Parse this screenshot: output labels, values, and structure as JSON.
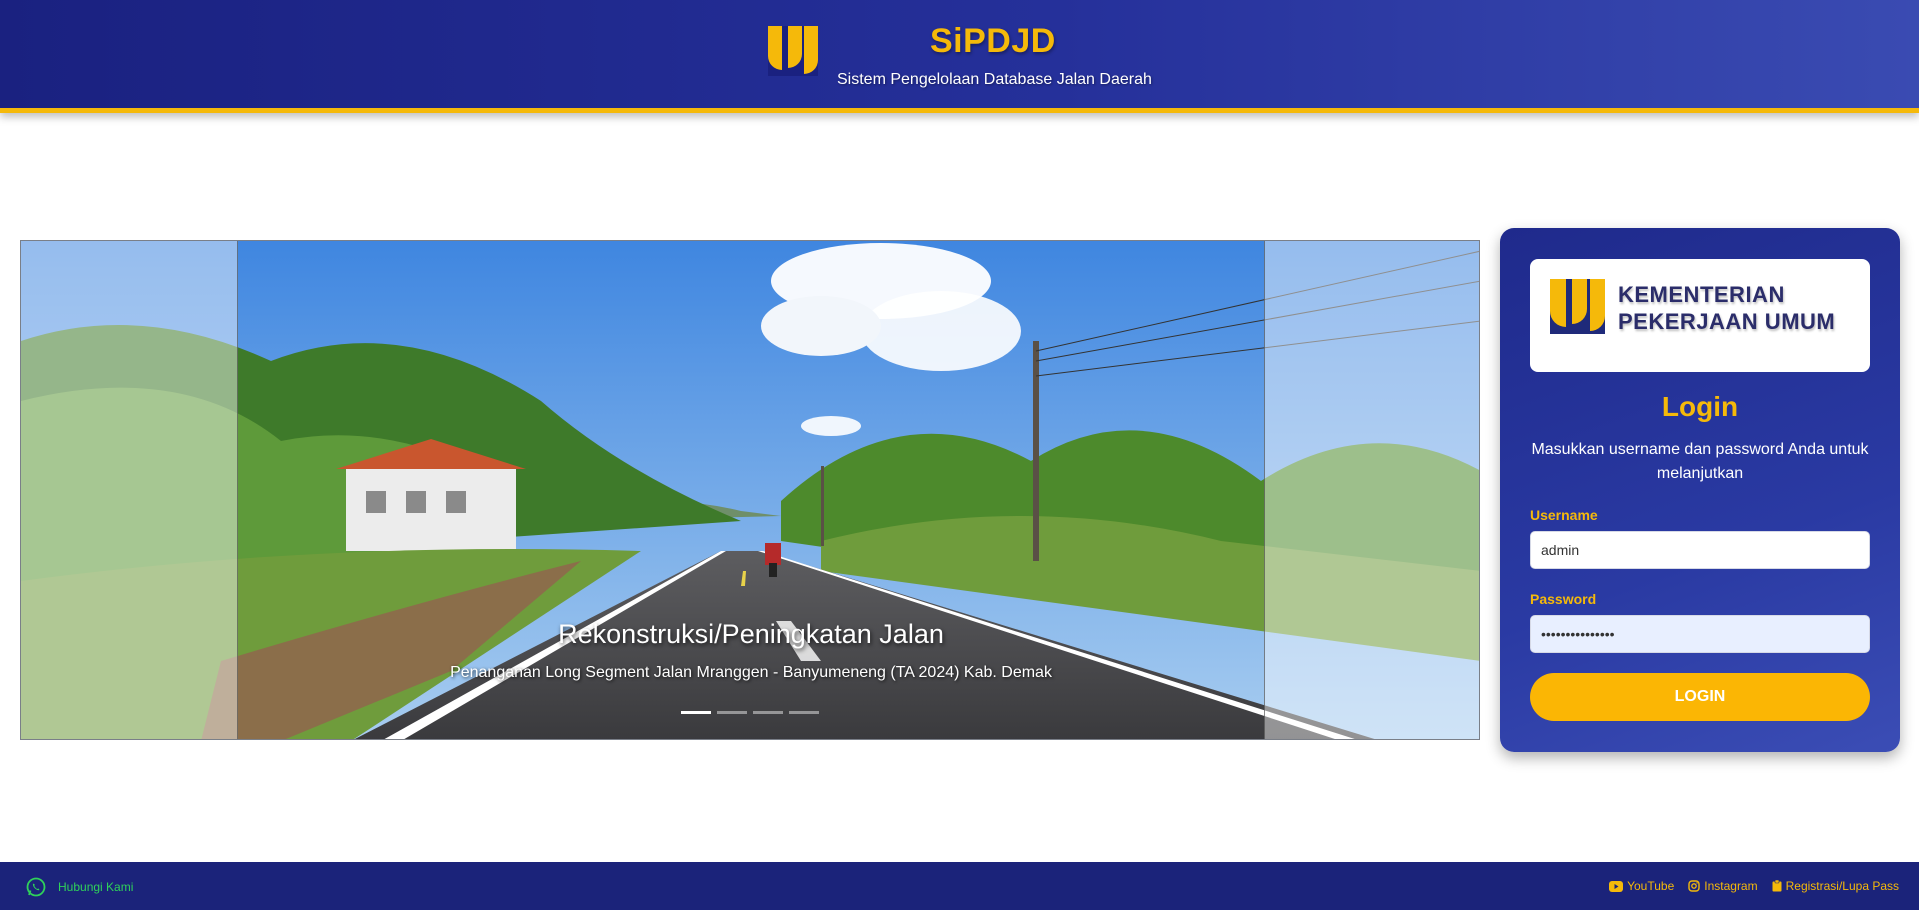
{
  "header": {
    "title": "SiPDJD",
    "subtitle": "Sistem Pengelolaan Database Jalan Daerah",
    "logo_icon": "pupr-logo-icon"
  },
  "carousel": {
    "caption_title": "Rekonstruksi/Peningkatan Jalan",
    "caption_subtitle": "Penanganan Long Segment Jalan Mranggen - Banyumeneng (TA 2024) Kab. Demak",
    "slide_count": 4,
    "active_slide": 1
  },
  "login": {
    "brand_line1": "KEMENTERIAN",
    "brand_line2": "PEKERJAAN UMUM",
    "title": "Login",
    "description": "Masukkan username dan password Anda untuk melanjutkan",
    "username_label": "Username",
    "username_value": "admin",
    "password_label": "Password",
    "password_value": "•••••••••••••••",
    "button_label": "LOGIN"
  },
  "footer": {
    "contact_label": "Hubungi Kami",
    "contact_icon": "whatsapp-icon",
    "youtube_label": "YouTube",
    "instagram_label": "Instagram",
    "register_label": "Registrasi/Lupa Pass"
  },
  "colors": {
    "accent": "#f5b90a",
    "header_blue": "#1a2180",
    "card_blue": "#2a3aa3",
    "button_yellow": "#fbb604",
    "whatsapp_green": "#2fd15a"
  }
}
